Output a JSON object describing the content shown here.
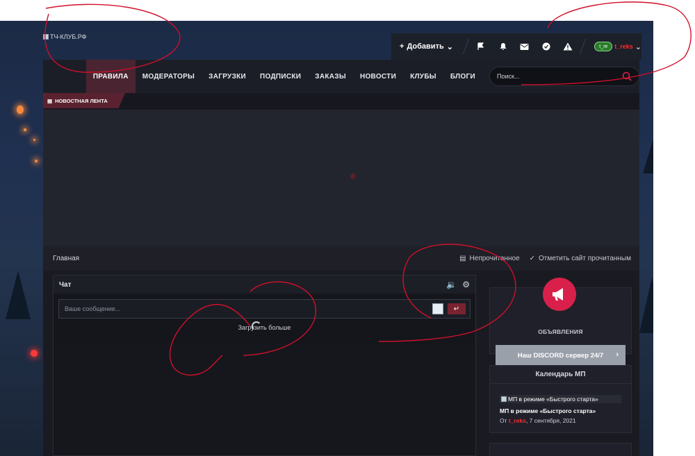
{
  "site": {
    "logo_alt": "ТЧ-КЛУБ.РФ"
  },
  "userbar": {
    "add_label": "Добавить",
    "icons": [
      "flag-icon",
      "bell-icon",
      "mail-icon",
      "check-circle-icon",
      "alert-icon"
    ],
    "avatar_text": "t_re",
    "username": "t_reks"
  },
  "nav": {
    "items": [
      {
        "label": "ПРАВИЛА",
        "active": true
      },
      {
        "label": "МОДЕРАТОРЫ"
      },
      {
        "label": "ЗАГРУЗКИ"
      },
      {
        "label": "ПОДПИСКИ"
      },
      {
        "label": "ЗАКАЗЫ"
      },
      {
        "label": "НОВОСТИ"
      },
      {
        "label": "КЛУБЫ"
      },
      {
        "label": "БЛОГИ"
      }
    ],
    "search_placeholder": "Поиск..."
  },
  "ticker": {
    "label": "НОВОСТНАЯ ЛЕНТА"
  },
  "breadcrumb": {
    "home": "Главная",
    "unread": "Непрочитанное",
    "mark_read": "Отметить сайт прочитанным"
  },
  "chat": {
    "title": "Чат",
    "placeholder": "Ваше сообщение...",
    "load_more": "Загрузить больше"
  },
  "announcements": {
    "title": "ОБЪЯВЛЕНИЯ",
    "discord_button": "Наш DISCORD сервер 24/7"
  },
  "calendar": {
    "title": "Календарь МП",
    "thumb_alt": "МП в режиме «Быстрого старта»",
    "event_title": "МП в режиме «Быстрого старта»",
    "by_prefix": "От ",
    "by_user": "t_reks",
    "date_suffix": ", 7 сентября, 2021"
  },
  "colors": {
    "accent": "#7a2330",
    "megaphone": "#d8204a",
    "username": "#ff2b2b",
    "annotation": "#d0102a"
  }
}
